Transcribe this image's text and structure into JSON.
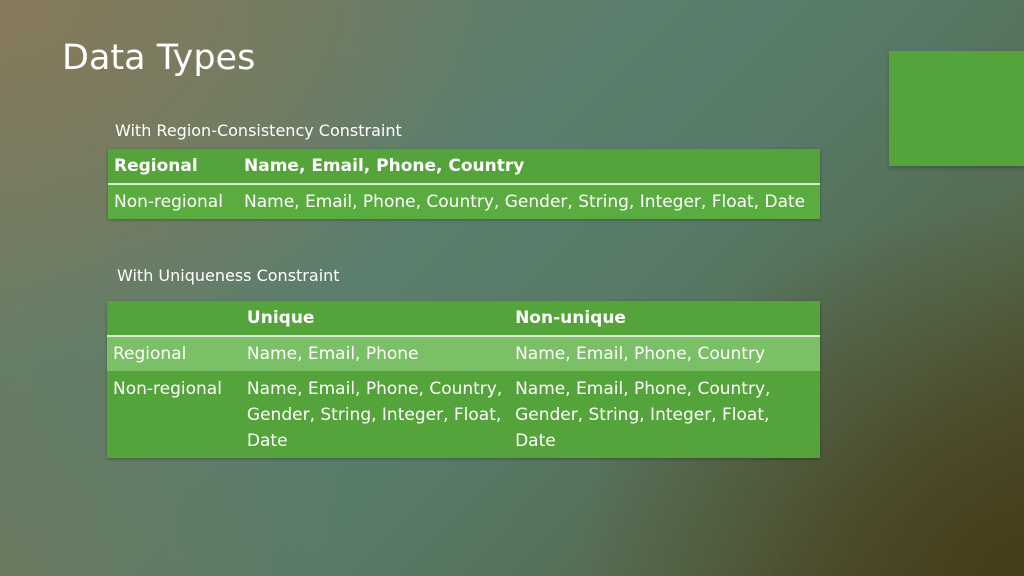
{
  "slide": {
    "title": "Data Types",
    "accent_color": "#55a33b"
  },
  "region_table": {
    "caption": "With Region-Consistency Constraint",
    "rows": [
      {
        "label": "Regional",
        "types": "Name, Email, Phone, Country"
      },
      {
        "label": "Non-regional",
        "types": "Name, Email, Phone, Country, Gender, String, Integer, Float, Date"
      }
    ]
  },
  "uniqueness_table": {
    "caption": "With Uniqueness Constraint",
    "headers": [
      "",
      "Unique",
      "Non-unique"
    ],
    "rows": [
      {
        "label": "Regional",
        "unique": "Name, Email, Phone",
        "non_unique": "Name, Email, Phone, Country"
      },
      {
        "label": "Non-regional",
        "unique": "Name, Email, Phone, Country, Gender, String, Integer, Float, Date",
        "non_unique": "Name, Email, Phone, Country, Gender, String, Integer, Float, Date"
      }
    ]
  }
}
